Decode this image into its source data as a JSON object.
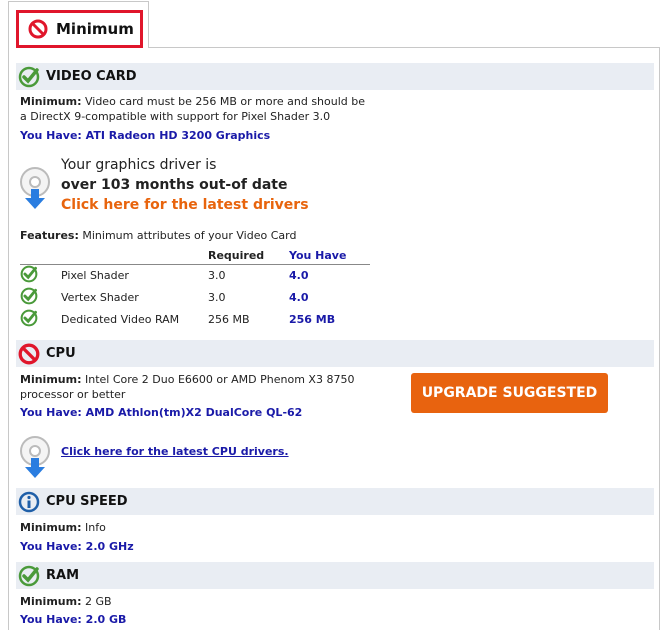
{
  "tab": {
    "label": "Minimum"
  },
  "video_card": {
    "title": "VIDEO CARD",
    "minimum_label": "Minimum:",
    "minimum_text_1": "Video card must be 256 MB or more and should be",
    "minimum_text_2": "a DirectX 9-compatible with support for Pixel Shader 3.0",
    "you_have": "You Have: ATI Radeon HD 3200 Graphics",
    "driver_line1": "Your graphics driver is",
    "driver_line2": "over 103 months out-of date",
    "driver_link": "Click here for the latest drivers",
    "features_label": "Features:",
    "features_text": "Minimum attributes of your Video Card",
    "table": {
      "headers": [
        "",
        "",
        "Required",
        "You Have"
      ],
      "rows": [
        {
          "name": "Pixel Shader",
          "required": "3.0",
          "have": "4.0"
        },
        {
          "name": "Vertex Shader",
          "required": "3.0",
          "have": "4.0"
        },
        {
          "name": "Dedicated Video RAM",
          "required": "256 MB",
          "have": "256 MB"
        }
      ]
    }
  },
  "cpu": {
    "title": "CPU",
    "minimum_label": "Minimum:",
    "minimum_text_1": "Intel Core 2 Duo E6600 or AMD Phenom X3 8750",
    "minimum_text_2": "processor or better",
    "you_have": "You Have: AMD Athlon(tm)X2 DualCore QL-62",
    "upgrade": "UPGRADE SUGGESTED",
    "driver_link": "Click here for the latest CPU drivers."
  },
  "cpu_speed": {
    "title": "CPU SPEED",
    "minimum_label": "Minimum:",
    "minimum_text": "Info",
    "you_have": "You Have: 2.0 GHz"
  },
  "ram": {
    "title": "RAM",
    "minimum_label": "Minimum:",
    "minimum_text": "2 GB",
    "you_have": "You Have: 2.0 GB"
  },
  "colors": {
    "pass": "#4a9a3a",
    "fail": "#e0162b",
    "info": "#1f5fa8",
    "accent": "#e8630f",
    "link": "#1a1aa8"
  }
}
